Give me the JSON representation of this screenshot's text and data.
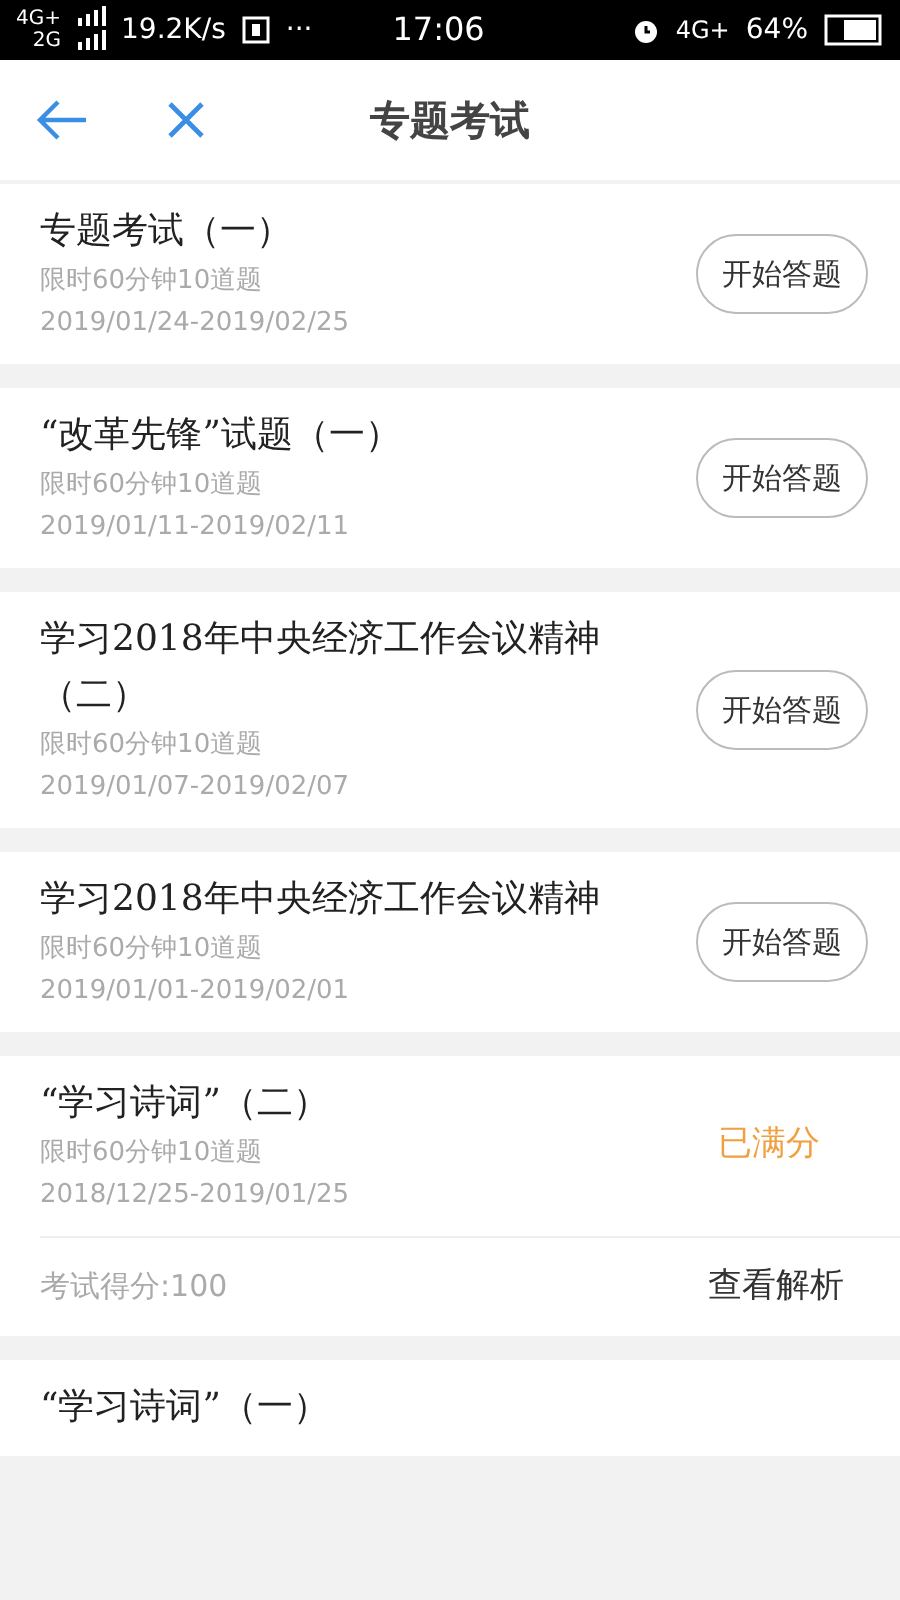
{
  "status_bar": {
    "network_1": "4G+",
    "network_2": "2G",
    "speed": "19.2K/s",
    "more": "···",
    "time": "17:06",
    "network_3": "4G+",
    "battery": "64%"
  },
  "nav": {
    "title": "专题考试"
  },
  "exams": [
    {
      "kind": "start",
      "title": "专题考试（一）",
      "limit": "限时60分钟10道题",
      "dates": "2019/01/24-2019/02/25",
      "action": "开始答题"
    },
    {
      "kind": "start",
      "title": "“改革先锋”试题（一）",
      "limit": "限时60分钟10道题",
      "dates": "2019/01/11-2019/02/11",
      "action": "开始答题"
    },
    {
      "kind": "start",
      "title": "学习2018年中央经济工作会议精神（二）",
      "limit": "限时60分钟10道题",
      "dates": "2019/01/07-2019/02/07",
      "action": "开始答题"
    },
    {
      "kind": "start",
      "title": "学习2018年中央经济工作会议精神",
      "limit": "限时60分钟10道题",
      "dates": "2019/01/01-2019/02/01",
      "action": "开始答题"
    },
    {
      "kind": "done",
      "title": "“学习诗词”（二）",
      "limit": "限时60分钟10道题",
      "dates": "2018/12/25-2019/01/25",
      "action": "已满分",
      "score": "考试得分:100",
      "review": "查看解析"
    },
    {
      "kind": "title_only",
      "title": "“学习诗词”（一）"
    }
  ]
}
